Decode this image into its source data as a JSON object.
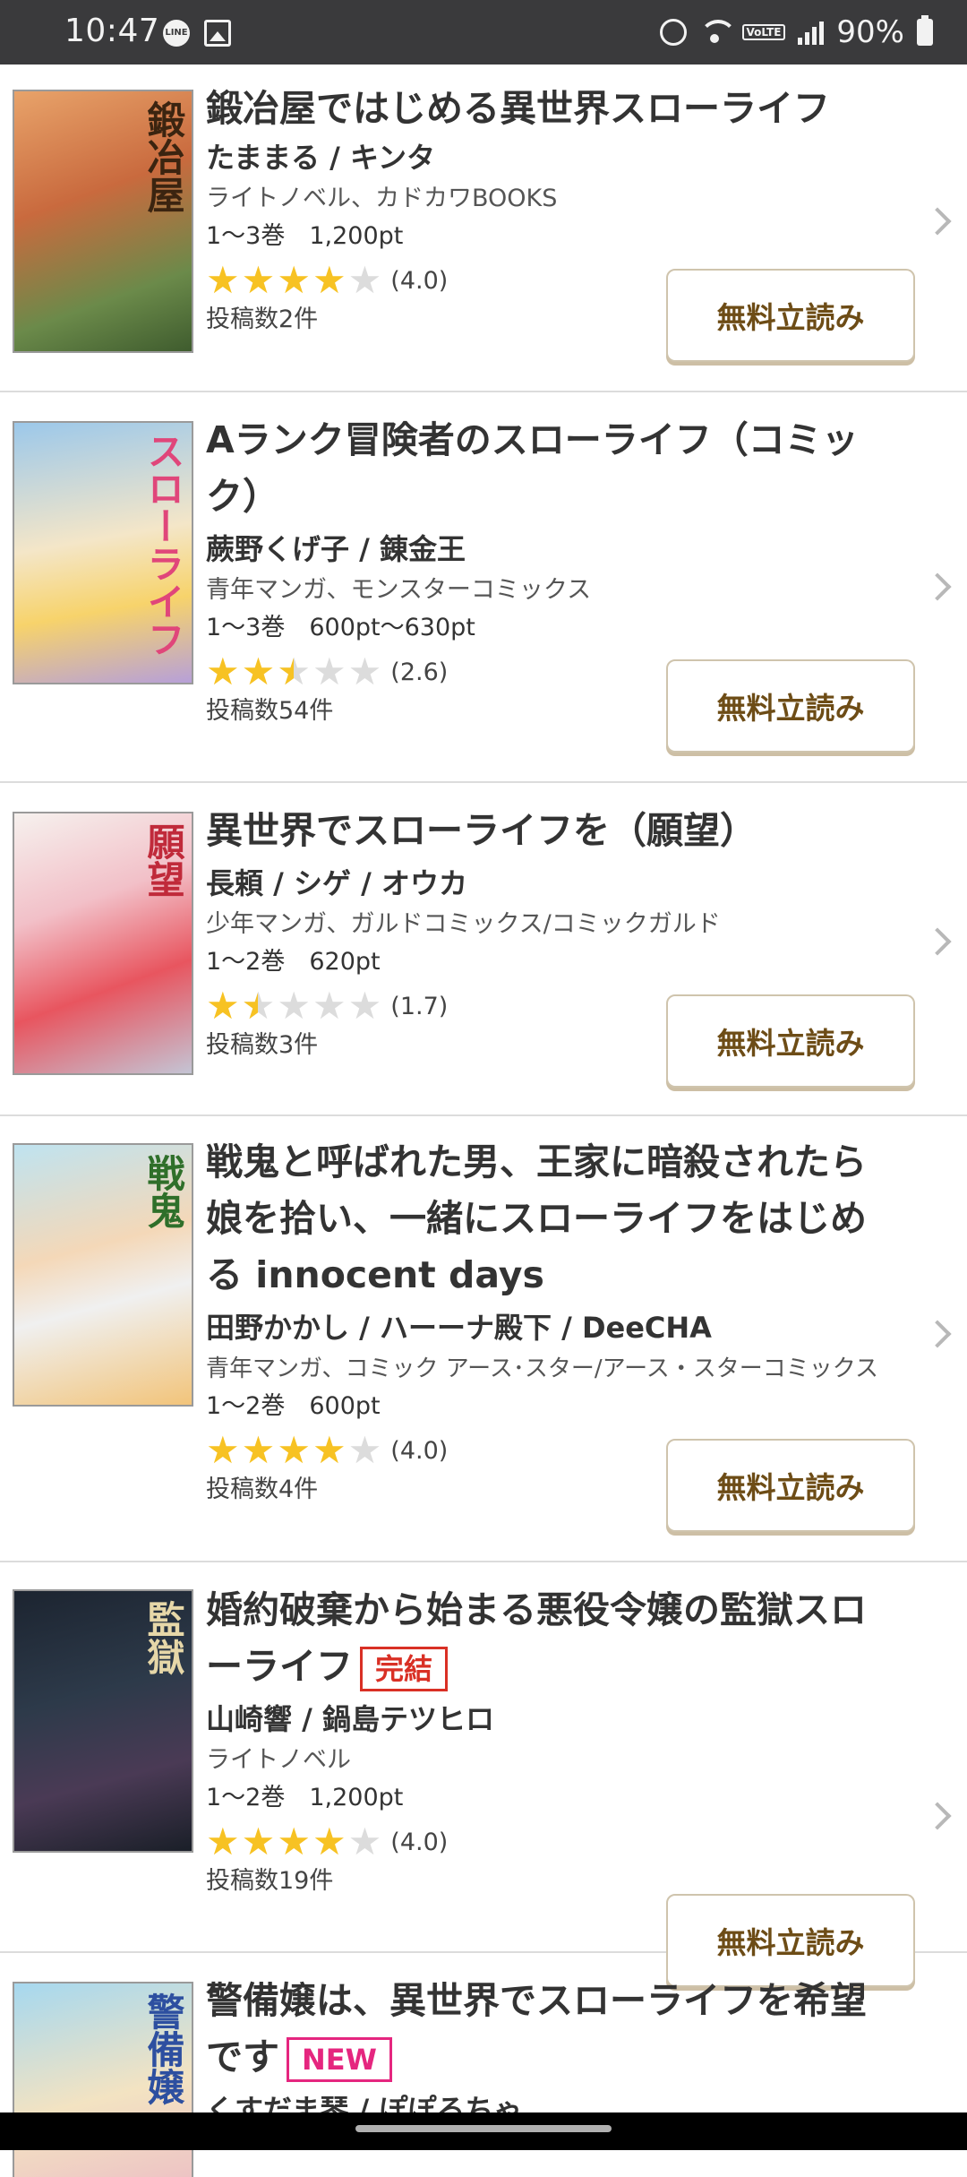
{
  "status_bar": {
    "time": "10:47",
    "line_icon": "LINE",
    "volte": "VoLTE",
    "battery": "90%"
  },
  "items": [
    {
      "title": "鍛冶屋ではじめる異世界スローライフ",
      "author": "たままる / キンタ",
      "genre": "ライトノベル、カドカワBOOKS",
      "volumes": "1〜3巻　1,200pt",
      "rating": 4.0,
      "score_label": "(4.0)",
      "posts": "投稿数2件",
      "button": "無料立読み",
      "cover_text": "鍛冶屋"
    },
    {
      "title": "Aランク冒険者のスローライフ（コミック）",
      "author": "蕨野くげ子 / 錬金王",
      "genre": "青年マンガ、モンスターコミックス",
      "volumes": "1〜3巻　600pt〜630pt",
      "rating": 2.6,
      "score_label": "(2.6)",
      "posts": "投稿数54件",
      "button": "無料立読み",
      "cover_text": "スローライフ"
    },
    {
      "title": "異世界でスローライフを（願望）",
      "author": "長頼 / シゲ / オウカ",
      "genre": "少年マンガ、ガルドコミックス/コミックガルド",
      "volumes": "1〜2巻　620pt",
      "rating": 1.7,
      "score_label": "(1.7)",
      "posts": "投稿数3件",
      "button": "無料立読み",
      "cover_text": "願望"
    },
    {
      "title": "戦鬼と呼ばれた男、王家に暗殺されたら娘を拾い、一緒にスローライフをはじめる innocent days",
      "author": "田野かかし / ハーーナ殿下 / DeeCHA",
      "genre": "青年マンガ、コミック アース･スター/アース・スターコミックス",
      "volumes": "1〜2巻　600pt",
      "rating": 4.0,
      "score_label": "(4.0)",
      "posts": "投稿数4件",
      "button": "無料立読み",
      "cover_text": "戦鬼"
    },
    {
      "title": "婚約破棄から始まる悪役令嬢の監獄スローライフ",
      "badge": "完結",
      "author": "山崎響 / 鍋島テツヒロ",
      "genre": "ライトノベル",
      "volumes": "1〜2巻　1,200pt",
      "rating": 4.0,
      "score_label": "(4.0)",
      "posts": "投稿数19件",
      "button": "無料立読み",
      "cover_text": "監獄"
    },
    {
      "title": "警備嬢は、異世界でスローライフを希望です",
      "badge": "NEW",
      "author": "くすだま琴 / ぽぽるちゃ",
      "cover_text": "警備嬢"
    }
  ],
  "colors": {
    "star": "#f7c223",
    "button_text": "#6d4c16",
    "badge_complete": "#d93025",
    "badge_new": "#e5267f"
  }
}
